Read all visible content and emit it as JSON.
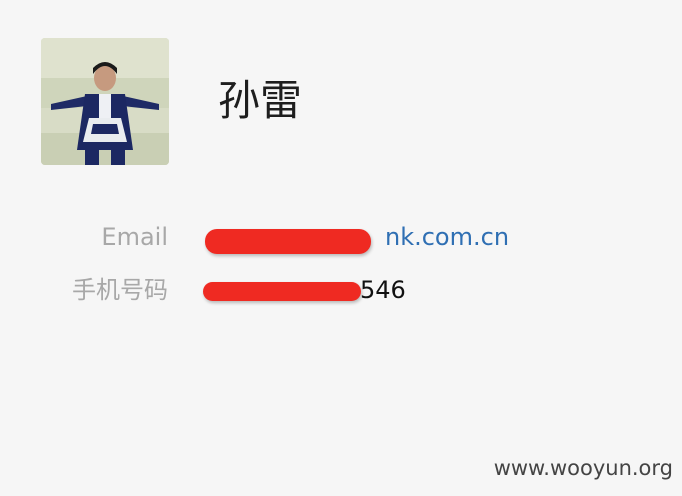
{
  "profile": {
    "name": "孙雷",
    "avatar_icon": "user-photo"
  },
  "fields": {
    "email": {
      "label": "Email",
      "value_visible": "nk.com.cn"
    },
    "phone": {
      "label": "手机号码",
      "value_visible": "546"
    }
  },
  "watermark": "www.wooyun.org",
  "colors": {
    "background": "#f6f6f6",
    "label": "#a8a8a8",
    "link": "#2f6fb3",
    "redaction": "#ef2a22"
  }
}
